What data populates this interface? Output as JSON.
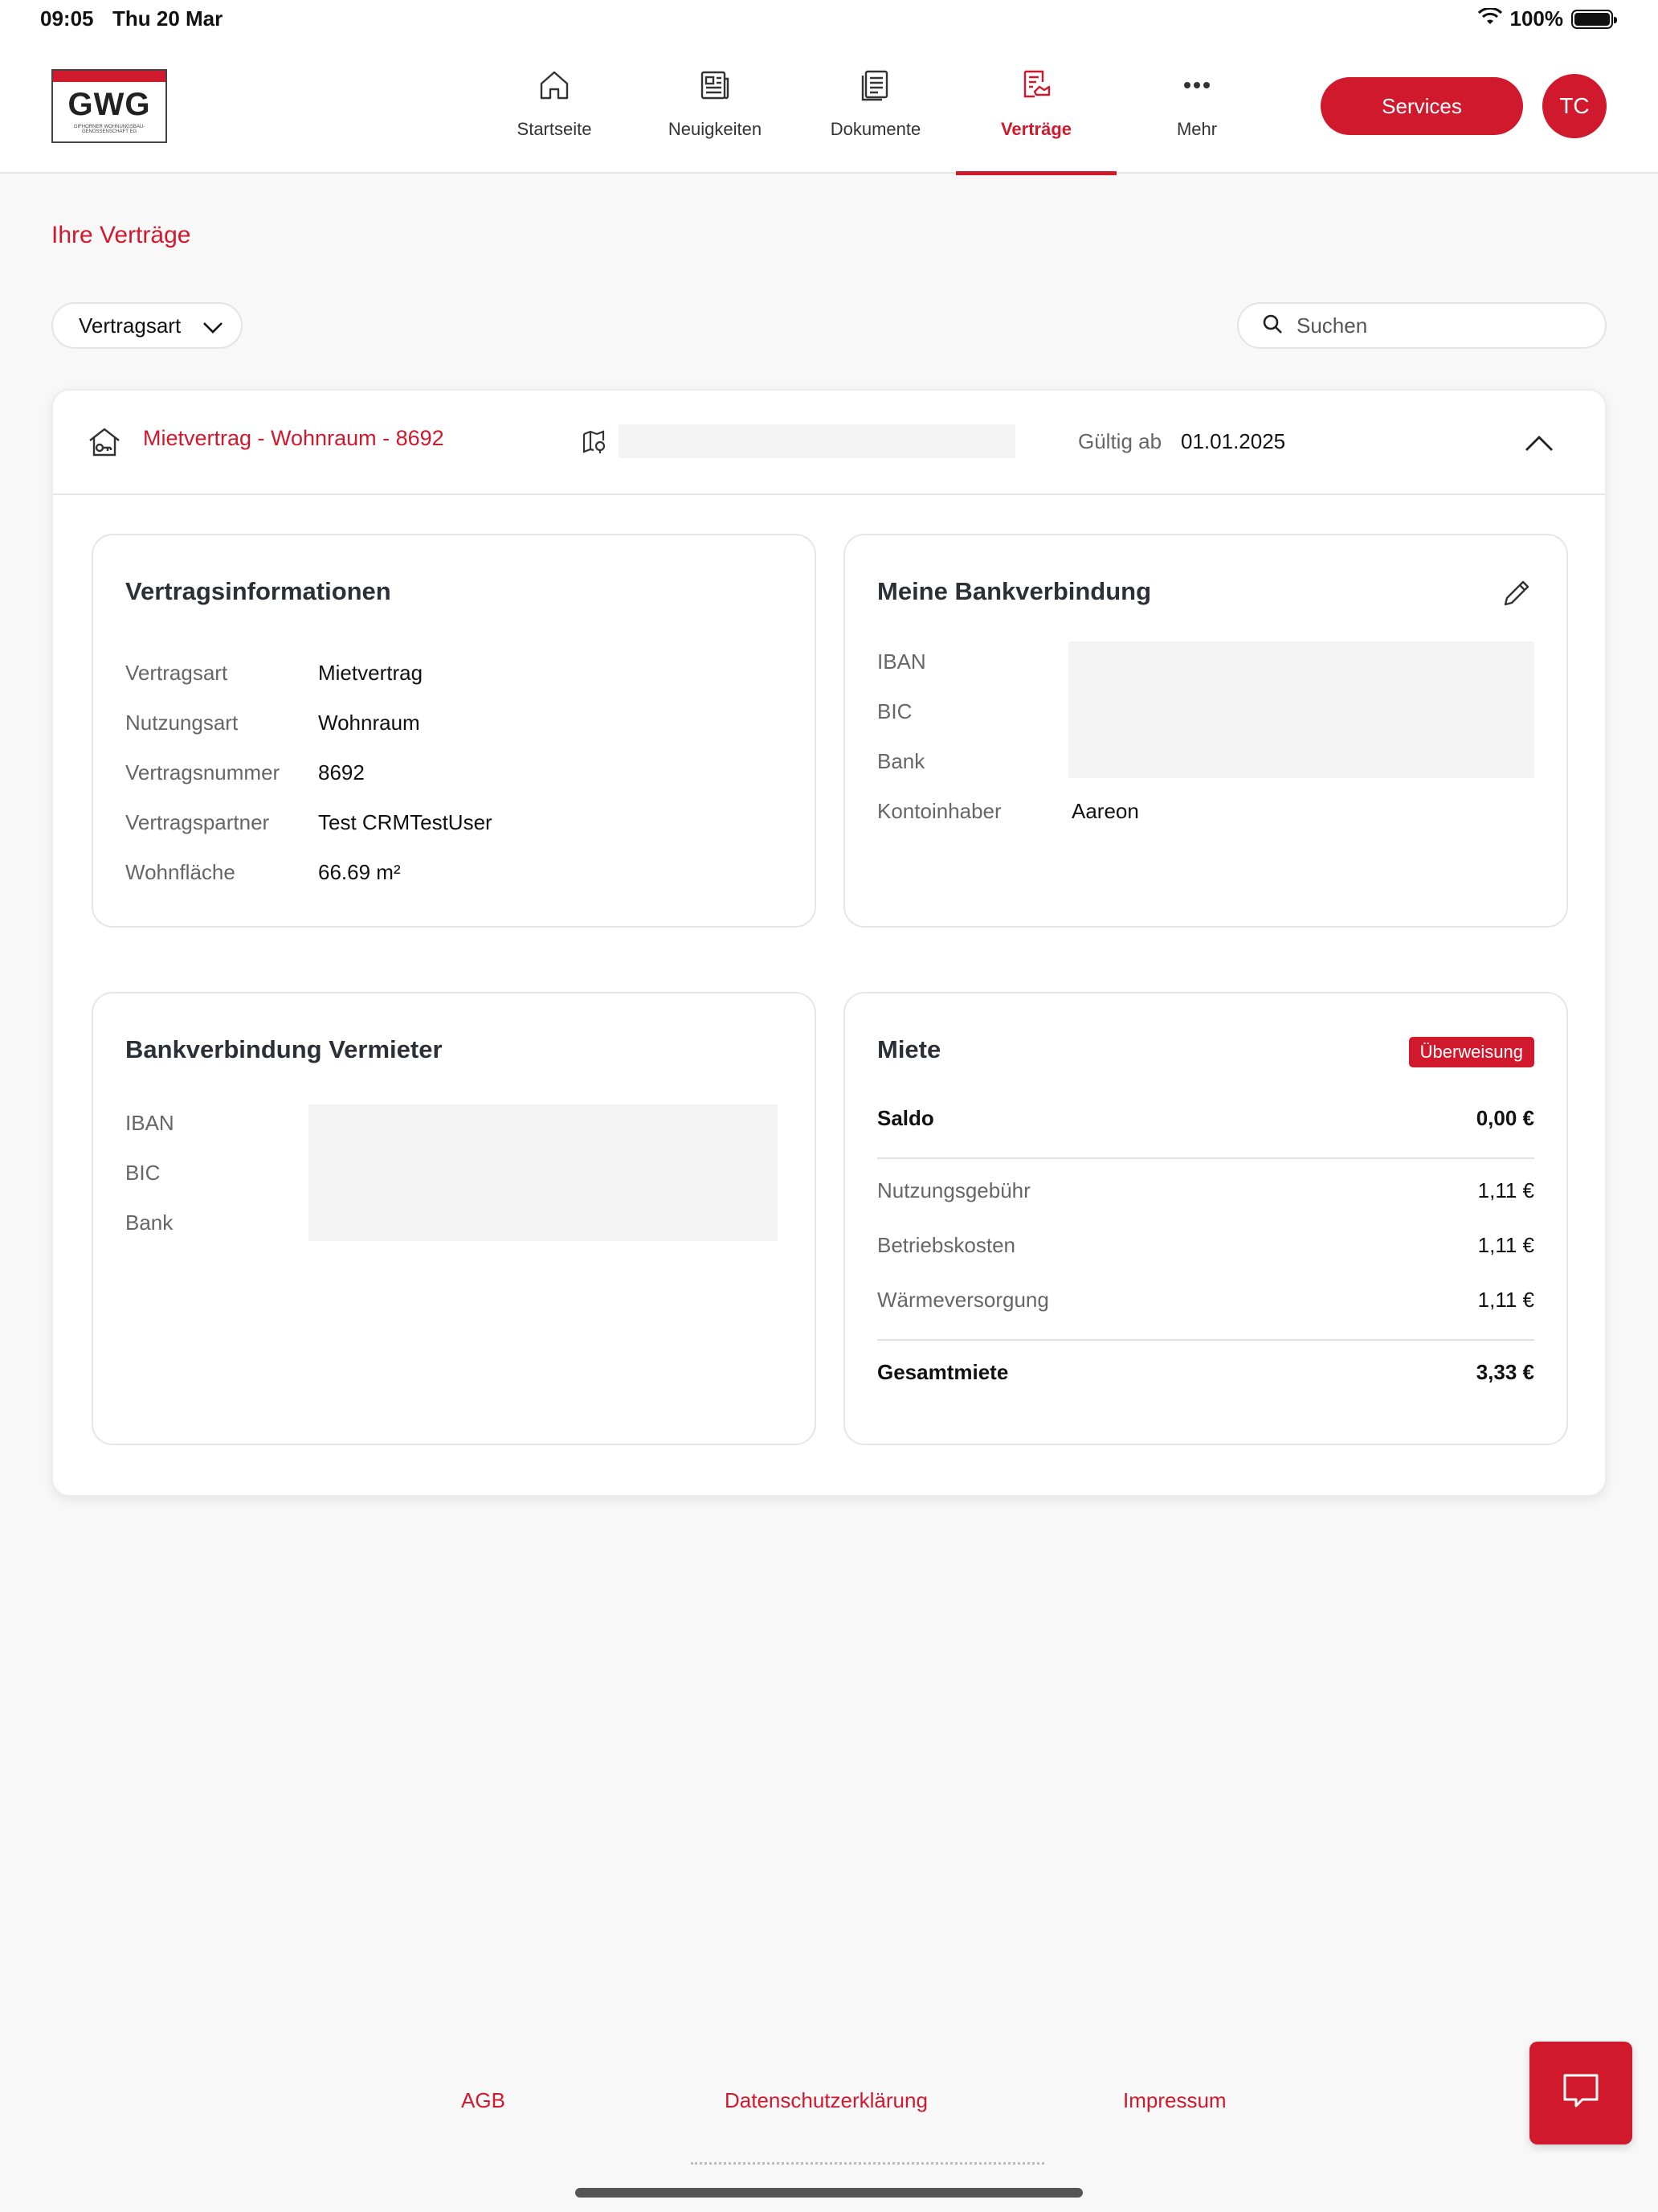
{
  "status_bar": {
    "time": "09:05",
    "date": "Thu 20 Mar",
    "battery": "100%"
  },
  "header": {
    "logo_text": "GWG",
    "logo_subtext": "GIFHORNER WOHNUNGSBAU-GENOSSENSCHAFT EG",
    "nav": [
      {
        "label": "Startseite",
        "icon": "home-icon",
        "active": false
      },
      {
        "label": "Neuigkeiten",
        "icon": "newspaper-icon",
        "active": false
      },
      {
        "label": "Dokumente",
        "icon": "documents-icon",
        "active": false
      },
      {
        "label": "Verträge",
        "icon": "contract-icon",
        "active": true
      },
      {
        "label": "Mehr",
        "icon": "more-icon",
        "active": false
      }
    ],
    "services_label": "Services",
    "avatar_initials": "TC"
  },
  "page": {
    "title": "Ihre Verträge",
    "filter_label": "Vertragsart",
    "search_placeholder": "Suchen"
  },
  "contract": {
    "title": "Mietvertrag - Wohnraum - 8692",
    "valid_label": "Gültig ab",
    "valid_value": "01.01.2025",
    "info": {
      "heading": "Vertragsinformationen",
      "rows": [
        {
          "label": "Vertragsart",
          "value": "Mietvertrag"
        },
        {
          "label": "Nutzungsart",
          "value": "Wohnraum"
        },
        {
          "label": "Vertragsnummer",
          "value": "8692"
        },
        {
          "label": "Vertragspartner",
          "value": "Test CRMTestUser"
        },
        {
          "label": "Wohnfläche",
          "value": "66.69 m²"
        }
      ]
    },
    "my_bank": {
      "heading": "Meine Bankverbindung",
      "iban_label": "IBAN",
      "bic_label": "BIC",
      "bank_label": "Bank",
      "holder_label": "Kontoinhaber",
      "holder_value": "Aareon"
    },
    "landlord_bank": {
      "heading": "Bankverbindung Vermieter",
      "iban_label": "IBAN",
      "bic_label": "BIC",
      "bank_label": "Bank"
    },
    "rent": {
      "heading": "Miete",
      "badge": "Überweisung",
      "saldo_label": "Saldo",
      "saldo_value": "0,00 €",
      "items": [
        {
          "label": "Nutzungsgebühr",
          "value": "1,11 €"
        },
        {
          "label": "Betriebskosten",
          "value": "1,11 €"
        },
        {
          "label": "Wärmeversorgung",
          "value": "1,11 €"
        }
      ],
      "total_label": "Gesamtmiete",
      "total_value": "3,33 €"
    }
  },
  "footer": {
    "links": [
      "AGB",
      "Datenschutzerklärung",
      "Impressum"
    ]
  },
  "colors": {
    "accent": "#d0192d",
    "background": "#f8f8f8",
    "card": "#ffffff"
  }
}
